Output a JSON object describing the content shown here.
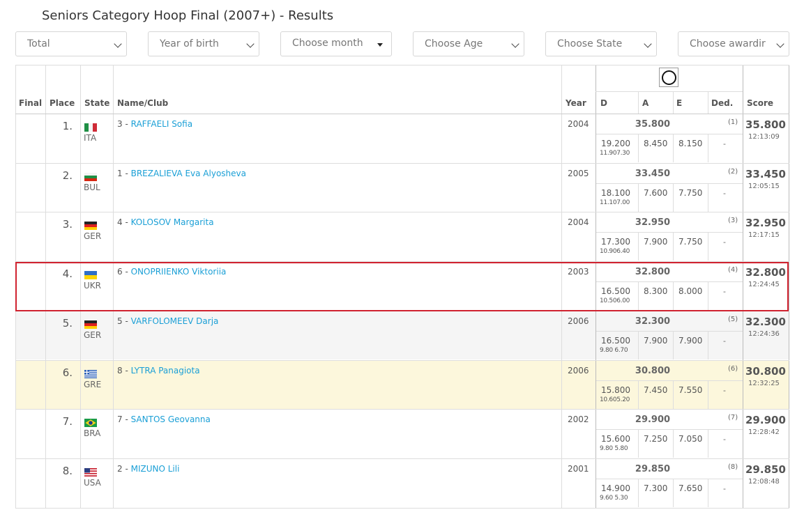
{
  "title": "Seniors Category Hoop Final (2007+) - Results",
  "filters": [
    {
      "label": "Total",
      "kind": "chevron"
    },
    {
      "label": "Year of birth",
      "kind": "chevron"
    },
    {
      "label": "Choose month",
      "kind": "caret"
    },
    {
      "label": "Choose Age",
      "kind": "chevron"
    },
    {
      "label": "Choose State",
      "kind": "chevron"
    },
    {
      "label": "Choose awardir",
      "kind": "chevron"
    }
  ],
  "columns": {
    "final": "Final",
    "place": "Place",
    "state": "State",
    "name": "Name/Club",
    "year": "Year",
    "d": "D",
    "a": "A",
    "e": "E",
    "ded": "Ded.",
    "score": "Score"
  },
  "apparatus_icon": "hoop-icon",
  "colors": {
    "link": "#1a9fd6",
    "highlight": "#d0222f",
    "row_yellow": "#fcf7dc",
    "row_gray": "#f5f5f5"
  },
  "rows": [
    {
      "place": "1.",
      "flag": "italy-flag-icon",
      "state": "ITA",
      "num": "3 - ",
      "name": "RAFFAELI Sofia",
      "year": "2004",
      "total": "35.800",
      "rank": "(1)",
      "score": "35.800",
      "time": "12:13:09",
      "d": "19.200",
      "dsub": "11.907.30",
      "a": "8.450",
      "e": "8.150",
      "ded": "-"
    },
    {
      "place": "2.",
      "flag": "bulgaria-flag-icon",
      "state": "BUL",
      "num": "1 - ",
      "name": "BREZALIEVA Eva Alyosheva",
      "year": "2005",
      "total": "33.450",
      "rank": "(2)",
      "score": "33.450",
      "time": "12:05:15",
      "d": "18.100",
      "dsub": "11.107.00",
      "a": "7.600",
      "e": "7.750",
      "ded": "-"
    },
    {
      "place": "3.",
      "flag": "germany-flag-icon",
      "state": "GER",
      "num": "4 - ",
      "name": "KOLOSOV Margarita",
      "year": "2004",
      "total": "32.950",
      "rank": "(3)",
      "score": "32.950",
      "time": "12:17:15",
      "d": "17.300",
      "dsub": "10.906.40",
      "a": "7.900",
      "e": "7.750",
      "ded": "-"
    },
    {
      "place": "4.",
      "flag": "ukraine-flag-icon",
      "state": "UKR",
      "num": "6 - ",
      "name": "ONOPRIIENKO Viktoriia",
      "year": "2003",
      "total": "32.800",
      "rank": "(4)",
      "score": "32.800",
      "time": "12:24:45",
      "d": "16.500",
      "dsub": "10.506.00",
      "a": "8.300",
      "e": "8.000",
      "ded": "-"
    },
    {
      "place": "5.",
      "flag": "germany-flag-icon",
      "state": "GER",
      "num": "5 - ",
      "name": "VARFOLOMEEV Darja",
      "year": "2006",
      "total": "32.300",
      "rank": "(5)",
      "score": "32.300",
      "time": "12:24:36",
      "d": "16.500",
      "dsub": "9.80 6.70",
      "a": "7.900",
      "e": "7.900",
      "ded": "-"
    },
    {
      "place": "6.",
      "flag": "greece-flag-icon",
      "state": "GRE",
      "num": "8 - ",
      "name": "LYTRA Panagiota",
      "year": "2006",
      "total": "30.800",
      "rank": "(6)",
      "score": "30.800",
      "time": "12:32:25",
      "d": "15.800",
      "dsub": "10.605.20",
      "a": "7.450",
      "e": "7.550",
      "ded": "-"
    },
    {
      "place": "7.",
      "flag": "brazil-flag-icon",
      "state": "BRA",
      "num": "7 - ",
      "name": "SANTOS Geovanna",
      "year": "2002",
      "total": "29.900",
      "rank": "(7)",
      "score": "29.900",
      "time": "12:28:42",
      "d": "15.600",
      "dsub": "9.80 5.80",
      "a": "7.250",
      "e": "7.050",
      "ded": "-"
    },
    {
      "place": "8.",
      "flag": "usa-flag-icon",
      "state": "USA",
      "num": "2 - ",
      "name": "MIZUNO Lili",
      "year": "2001",
      "total": "29.850",
      "rank": "(8)",
      "score": "29.850",
      "time": "12:08:48",
      "d": "14.900",
      "dsub": "9.60 5.30",
      "a": "7.300",
      "e": "7.650",
      "ded": "-"
    }
  ]
}
